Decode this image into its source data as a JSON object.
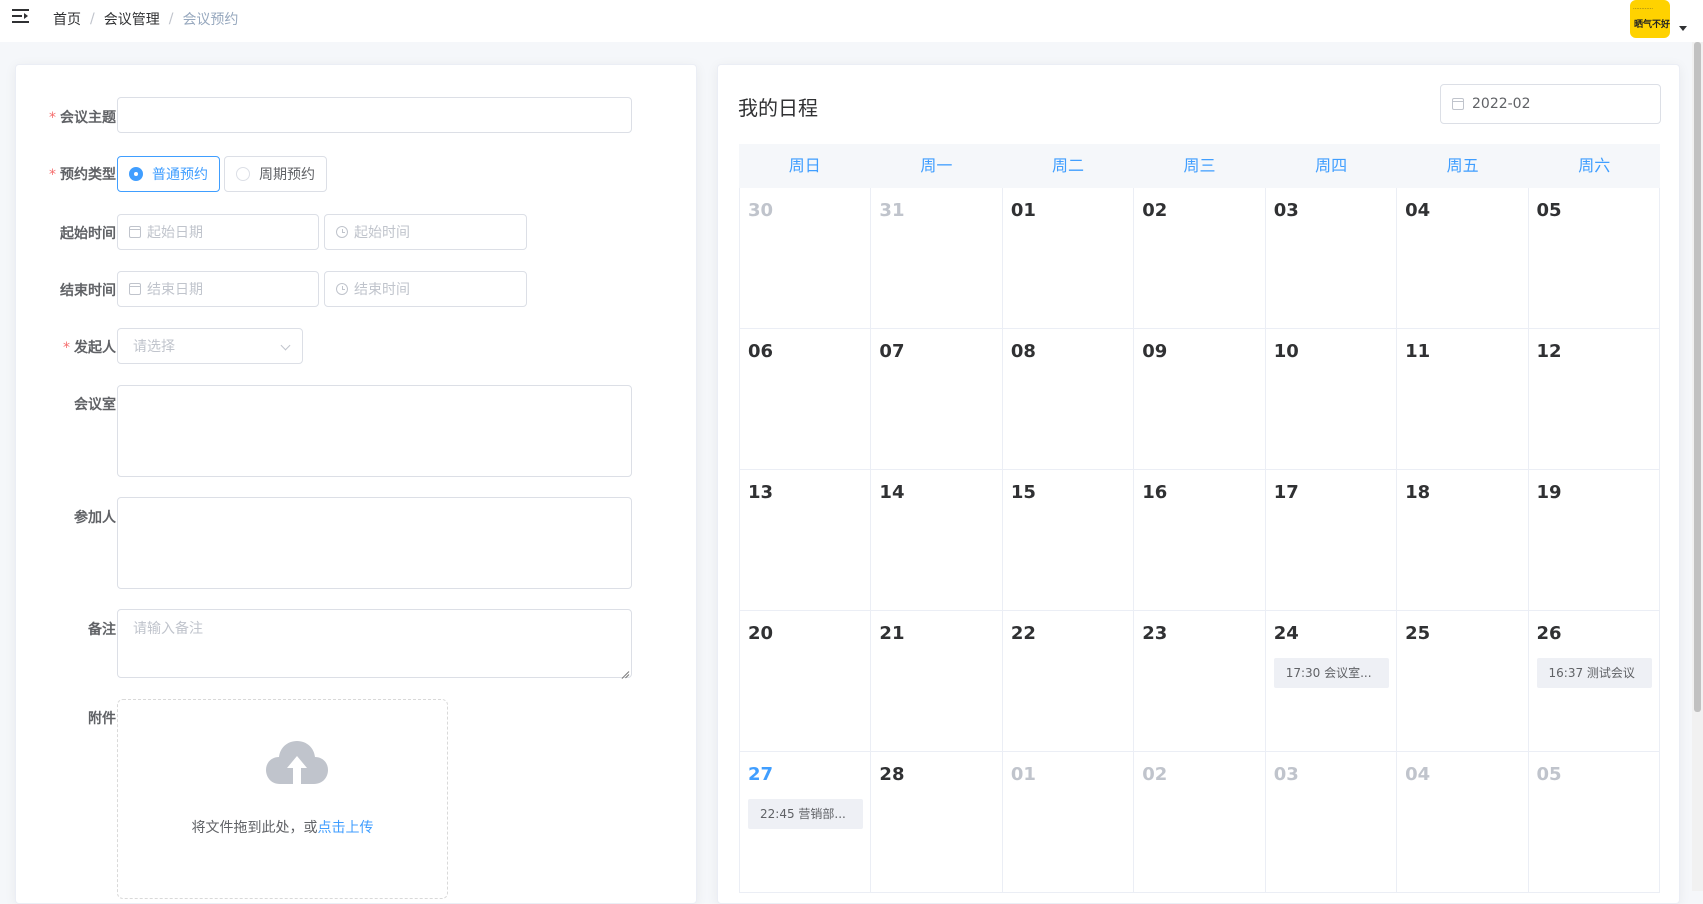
{
  "breadcrumb": [
    "首页",
    "会议管理",
    "会议预约"
  ],
  "breadcrumb_sep": "/",
  "avatar": {
    "line1": "…………",
    "line2": "晒气不好"
  },
  "form": {
    "topic_label": "会议主题",
    "type_label": "预约类型",
    "type_options": [
      "普通预约",
      "周期预约"
    ],
    "type_selected": "普通预约",
    "start_label": "起始时间",
    "start_date_placeholder": "起始日期",
    "start_time_placeholder": "起始时间",
    "end_label": "结束时间",
    "end_date_placeholder": "结束日期",
    "end_time_placeholder": "结束时间",
    "initiator_label": "发起人",
    "initiator_placeholder": "请选择",
    "room_label": "会议室",
    "participants_label": "参加人",
    "remark_label": "备注",
    "remark_placeholder": "请输入备注",
    "attachment_label": "附件",
    "upload_text": "将文件拖到此处，或",
    "upload_link": "点击上传"
  },
  "calendar": {
    "title": "我的日程",
    "month": "2022-02",
    "weekdays": [
      "周日",
      "周一",
      "周二",
      "周三",
      "周四",
      "周五",
      "周六"
    ],
    "weeks": [
      [
        {
          "d": "30",
          "o": true
        },
        {
          "d": "31",
          "o": true
        },
        {
          "d": "01"
        },
        {
          "d": "02"
        },
        {
          "d": "03"
        },
        {
          "d": "04"
        },
        {
          "d": "05"
        }
      ],
      [
        {
          "d": "06"
        },
        {
          "d": "07"
        },
        {
          "d": "08"
        },
        {
          "d": "09"
        },
        {
          "d": "10"
        },
        {
          "d": "11"
        },
        {
          "d": "12"
        }
      ],
      [
        {
          "d": "13"
        },
        {
          "d": "14"
        },
        {
          "d": "15"
        },
        {
          "d": "16"
        },
        {
          "d": "17"
        },
        {
          "d": "18"
        },
        {
          "d": "19"
        }
      ],
      [
        {
          "d": "20"
        },
        {
          "d": "21"
        },
        {
          "d": "22"
        },
        {
          "d": "23"
        },
        {
          "d": "24",
          "e": "17:30 会议室..."
        },
        {
          "d": "25"
        },
        {
          "d": "26",
          "e": "16:37 测试会议"
        }
      ],
      [
        {
          "d": "27",
          "t": true,
          "e": "22:45 营销部..."
        },
        {
          "d": "28"
        },
        {
          "d": "01",
          "o": true
        },
        {
          "d": "02",
          "o": true
        },
        {
          "d": "03",
          "o": true
        },
        {
          "d": "04",
          "o": true
        },
        {
          "d": "05",
          "o": true
        }
      ]
    ]
  },
  "colors": {
    "accent": "#409eff",
    "required": "#f56c6c"
  }
}
